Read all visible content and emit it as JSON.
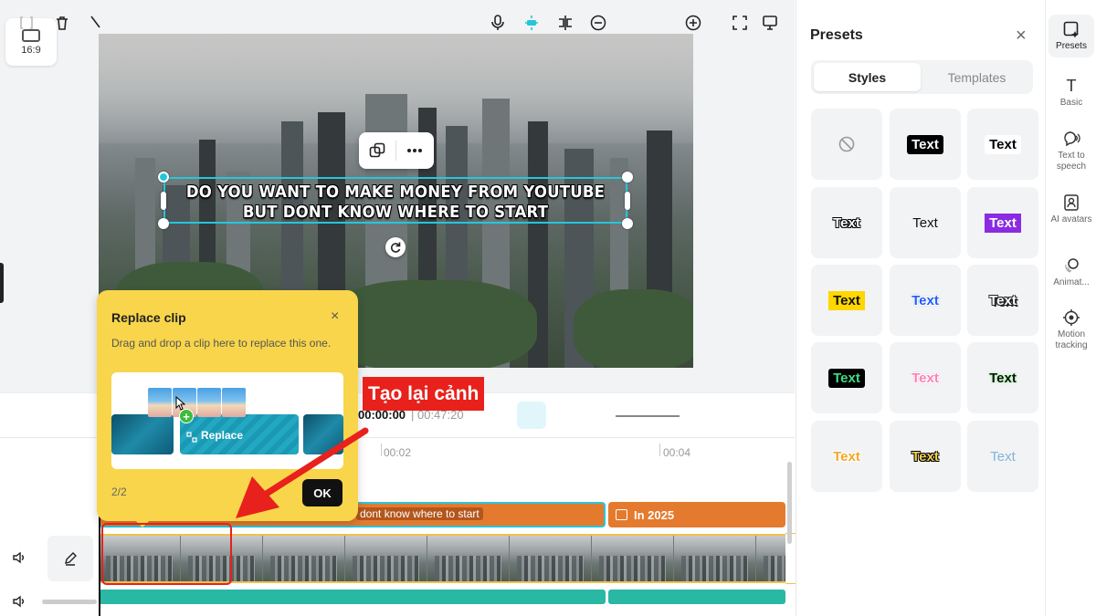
{
  "aspect_ratio_label": "16:9",
  "video": {
    "caption": "DO YOU WANT TO MAKE MONEY FROM YOUTUBE BUT DONT KNOW WHERE TO START"
  },
  "toolbar": {
    "current_time": "00:00:00",
    "total_time": "| 00:47:20"
  },
  "timeline": {
    "ruler": [
      "00:02",
      "00:04"
    ],
    "text_clip_1": "dont know where to start",
    "text_clip_2": "In 2025"
  },
  "popup": {
    "title": "Replace clip",
    "close": "×",
    "description": "Drag and drop a clip here to replace this one.",
    "replace_label": "Replace",
    "step": "2/2",
    "ok": "OK",
    "plus": "+"
  },
  "annotation": {
    "label": "Tạo lại cảnh",
    "color": "#e8211c"
  },
  "presets": {
    "title": "Presets",
    "close": "×",
    "tabs": [
      "Styles",
      "Templates"
    ],
    "active_tab": "Styles",
    "tile_text": "Text"
  },
  "rail": [
    {
      "label": "Presets",
      "icon": "presets-icon"
    },
    {
      "label": "Basic",
      "icon": "text-t-icon"
    },
    {
      "label": "Text to speech",
      "icon": "speech-icon"
    },
    {
      "label": "AI avatars",
      "icon": "avatar-icon"
    },
    {
      "label": "Animat...",
      "icon": "animation-icon"
    },
    {
      "label": "Motion tracking",
      "icon": "motion-tracking-icon"
    }
  ],
  "colors": {
    "selection": "#26c6da",
    "text_track": "#e47a2e",
    "audio_track": "#28b8a4",
    "popup_bg": "#f8d54a"
  }
}
